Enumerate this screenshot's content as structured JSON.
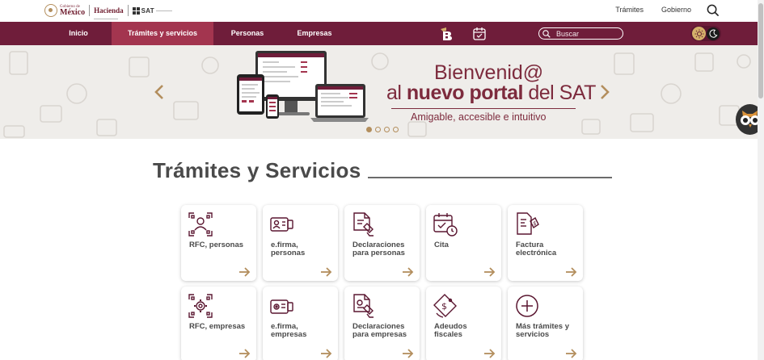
{
  "header": {
    "gov_small": "Gobierno de",
    "gov_big": "México",
    "hacienda": "Hacienda",
    "sat": "SAT",
    "links": [
      "Trámites",
      "Gobierno"
    ],
    "search_icon": "search-icon"
  },
  "nav": {
    "items": [
      {
        "label": "Inicio",
        "active": false
      },
      {
        "label": "Trámites y servicios",
        "active": true
      },
      {
        "label": "Personas",
        "active": false
      },
      {
        "label": "Empresas",
        "active": false
      }
    ],
    "search_placeholder": "Buscar",
    "icons": [
      "b-app-icon",
      "calendar-icon",
      "sun-icon",
      "moon-icon"
    ]
  },
  "hero": {
    "title_line1": "Bienvenid@",
    "title_line2_prefix": "al ",
    "title_line2_bold": "nuevo portal",
    "title_line2_suffix": " del SAT",
    "subtitle": "Amigable, accesible e intuitivo",
    "slides_count": 4,
    "active_slide": 1
  },
  "section": {
    "title": "Trámites y Servicios"
  },
  "cards": [
    {
      "label": "RFC, personas",
      "icon": "rfc-person-qr-icon"
    },
    {
      "label": "e.firma, personas",
      "icon": "efirma-id-card-icon"
    },
    {
      "label": "Declaraciones para personas",
      "icon": "declaration-document-icon"
    },
    {
      "label": "Cita",
      "icon": "calendar-clock-icon"
    },
    {
      "label": "Factura electrónica",
      "icon": "electronic-invoice-icon"
    },
    {
      "label": "RFC, empresas",
      "icon": "rfc-company-qr-icon"
    },
    {
      "label": "e.firma, empresas",
      "icon": "efirma-company-card-icon"
    },
    {
      "label": "Declaraciones para empresas",
      "icon": "company-declaration-icon"
    },
    {
      "label": "Adeudos fiscales",
      "icon": "tax-debt-tag-icon"
    },
    {
      "label": "Más trámites y servicios",
      "icon": "plus-circle-icon"
    }
  ],
  "colors": {
    "brand": "#6f1d3a",
    "brand_active": "#a3354f",
    "gold": "#b38e5d",
    "text": "#4a4a4a"
  }
}
